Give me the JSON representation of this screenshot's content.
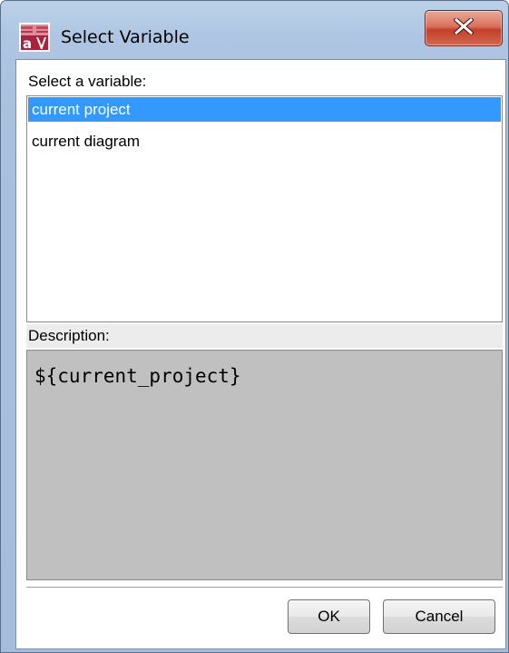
{
  "window": {
    "title": "Select Variable",
    "close_icon": "close-icon",
    "app_icon": "magicdraw-app-icon"
  },
  "variable_list": {
    "label": "Select a variable:",
    "items": [
      {
        "label": "current project",
        "selected": true
      },
      {
        "label": "current diagram",
        "selected": false
      }
    ]
  },
  "description": {
    "label": "Description:",
    "text": "${current_project}"
  },
  "buttons": {
    "ok_label": "OK",
    "cancel_label": "Cancel"
  },
  "colors": {
    "selection": "#3399ff",
    "description_bg": "#c0c0c0",
    "close_button": "#c4402a"
  }
}
